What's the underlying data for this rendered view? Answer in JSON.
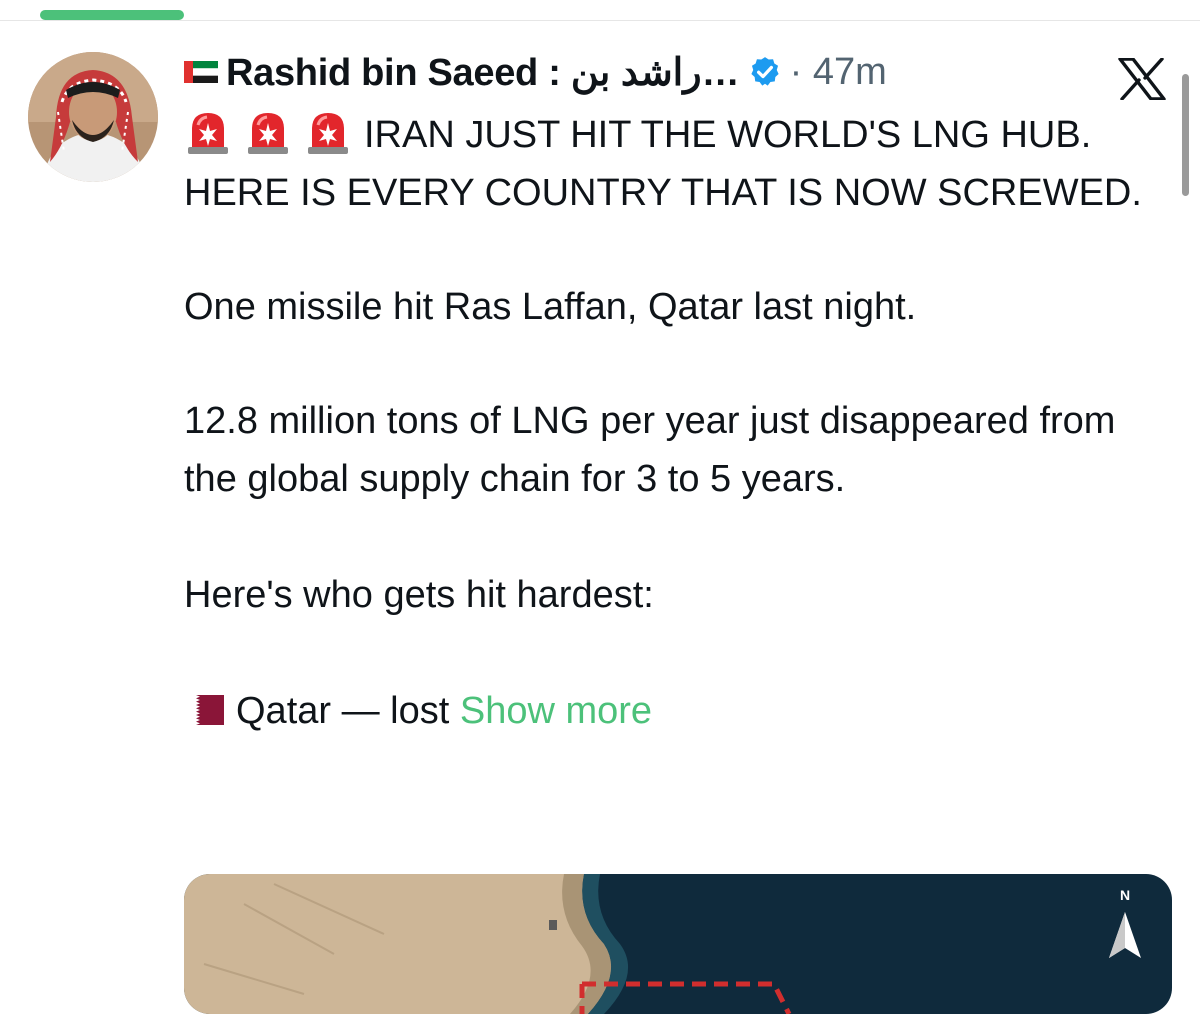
{
  "tweet": {
    "author_name": "Rashid bin Saeed : راشد بن…",
    "timestamp": "47m",
    "headline": "IRAN JUST HIT THE WORLD'S LNG HUB. HERE IS EVERY COUNTRY THAT IS NOW SCREWED.",
    "para1": "One missile hit Ras Laffan, Qatar last night.",
    "para2": "12.8 million tons of LNG per year just disappeared from the global supply chain for 3 to 5 years.",
    "para3": "Here's who gets hit hardest:",
    "para4": "Qatar — lost",
    "show_more": "Show more"
  },
  "icons": {
    "flag": "uae-flag-icon",
    "verified": "verified-badge-icon",
    "siren": "police-siren-emoji",
    "qatar_flag": "qatar-flag-icon",
    "x_logo": "x-logo-icon",
    "map_compass": "north-arrow-icon"
  },
  "map": {
    "compass_label": "N"
  },
  "colors": {
    "accent_green": "#4cc17a",
    "verified_blue": "#1d9bf0",
    "text": "#0f1419",
    "muted": "#536471"
  }
}
